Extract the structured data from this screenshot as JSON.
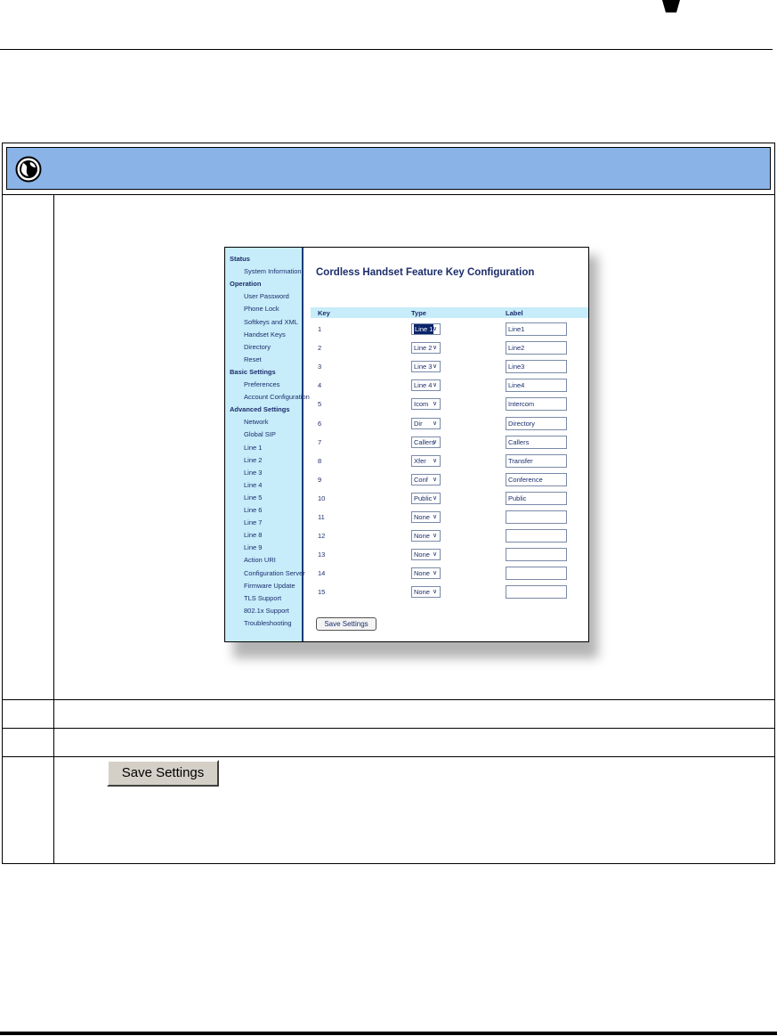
{
  "config_ui": {
    "sidebar": [
      {
        "type": "head",
        "label": "Status"
      },
      {
        "type": "sub",
        "label": "System Information"
      },
      {
        "type": "head",
        "label": "Operation"
      },
      {
        "type": "sub",
        "label": "User Password"
      },
      {
        "type": "sub",
        "label": "Phone Lock"
      },
      {
        "type": "sub",
        "label": "Softkeys and XML"
      },
      {
        "type": "sub",
        "label": "Handset Keys"
      },
      {
        "type": "sub",
        "label": "Directory"
      },
      {
        "type": "sub",
        "label": "Reset"
      },
      {
        "type": "head",
        "label": "Basic Settings"
      },
      {
        "type": "sub",
        "label": "Preferences"
      },
      {
        "type": "sub",
        "label": "Account Configuration"
      },
      {
        "type": "head",
        "label": "Advanced Settings"
      },
      {
        "type": "sub",
        "label": "Network"
      },
      {
        "type": "sub",
        "label": "Global SIP"
      },
      {
        "type": "sub",
        "label": "Line 1"
      },
      {
        "type": "sub",
        "label": "Line 2"
      },
      {
        "type": "sub",
        "label": "Line 3"
      },
      {
        "type": "sub",
        "label": "Line 4"
      },
      {
        "type": "sub",
        "label": "Line 5"
      },
      {
        "type": "sub",
        "label": "Line 6"
      },
      {
        "type": "sub",
        "label": "Line 7"
      },
      {
        "type": "sub",
        "label": "Line 8"
      },
      {
        "type": "sub",
        "label": "Line 9"
      },
      {
        "type": "sub",
        "label": "Action URI"
      },
      {
        "type": "sub",
        "label": "Configuration Server"
      },
      {
        "type": "sub",
        "label": "Firmware Update"
      },
      {
        "type": "sub",
        "label": "TLS Support"
      },
      {
        "type": "sub",
        "label": "802.1x Support"
      },
      {
        "type": "sub",
        "label": "Troubleshooting"
      }
    ],
    "title": "Cordless Handset Feature Key Configuration",
    "columns": {
      "key": "Key",
      "type": "Type",
      "label": "Label"
    },
    "rows": [
      {
        "key": "1",
        "type": "Line 1",
        "label": "Line1",
        "highlight": true
      },
      {
        "key": "2",
        "type": "Line 2",
        "label": "Line2"
      },
      {
        "key": "3",
        "type": "Line 3",
        "label": "Line3"
      },
      {
        "key": "4",
        "type": "Line 4",
        "label": "Line4"
      },
      {
        "key": "5",
        "type": "Icom",
        "label": "Intercom"
      },
      {
        "key": "6",
        "type": "Dir",
        "label": "Directory"
      },
      {
        "key": "7",
        "type": "Callers",
        "label": "Callers"
      },
      {
        "key": "8",
        "type": "Xfer",
        "label": "Transfer"
      },
      {
        "key": "9",
        "type": "Conf",
        "label": "Conference"
      },
      {
        "key": "10",
        "type": "Public",
        "label": "Public"
      },
      {
        "key": "11",
        "type": "None",
        "label": ""
      },
      {
        "key": "12",
        "type": "None",
        "label": ""
      },
      {
        "key": "13",
        "type": "None",
        "label": ""
      },
      {
        "key": "14",
        "type": "None",
        "label": ""
      },
      {
        "key": "15",
        "type": "None",
        "label": ""
      }
    ],
    "save_label": "Save Settings"
  },
  "step_button": {
    "label": "Save Settings"
  },
  "colors": {
    "banner": "#8ab4e8",
    "sidebar": "#c7ecfa",
    "text": "#1b2d6b"
  }
}
